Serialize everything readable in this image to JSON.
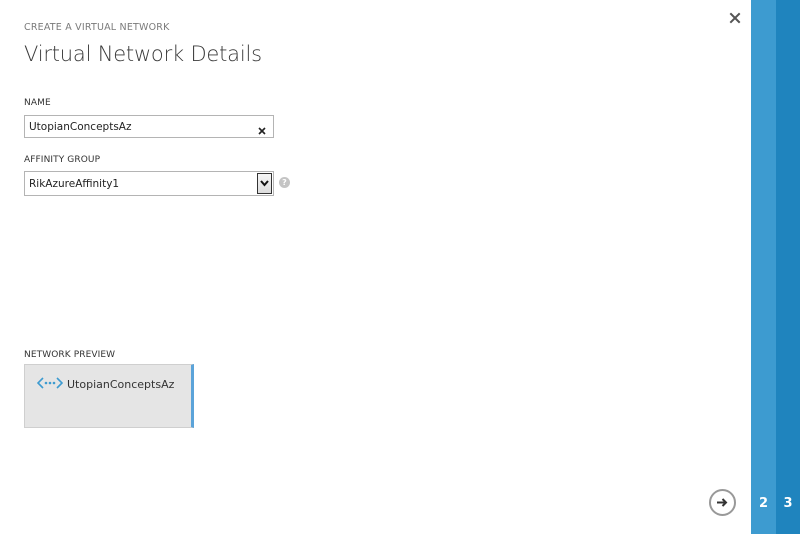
{
  "wizard": {
    "breadcrumb": "CREATE A VIRTUAL NETWORK",
    "title": "Virtual Network Details",
    "close_icon": "close-icon"
  },
  "form": {
    "name_label": "NAME",
    "name_value": "UtopianConceptsAz",
    "affinity_label": "AFFINITY GROUP",
    "affinity_value": "RikAzureAffinity1",
    "help_icon": "help-icon",
    "help_glyph": "?"
  },
  "preview": {
    "label": "NETWORK PREVIEW",
    "network_name": "UtopianConceptsAz",
    "icon": "virtual-network-icon"
  },
  "navigation": {
    "next_icon": "arrow-right-icon",
    "steps": [
      "2",
      "3"
    ]
  },
  "colors": {
    "accent": "#5ba3d9",
    "step_2_bg": "#3d9bd0",
    "step_3_bg": "#1f84be"
  }
}
